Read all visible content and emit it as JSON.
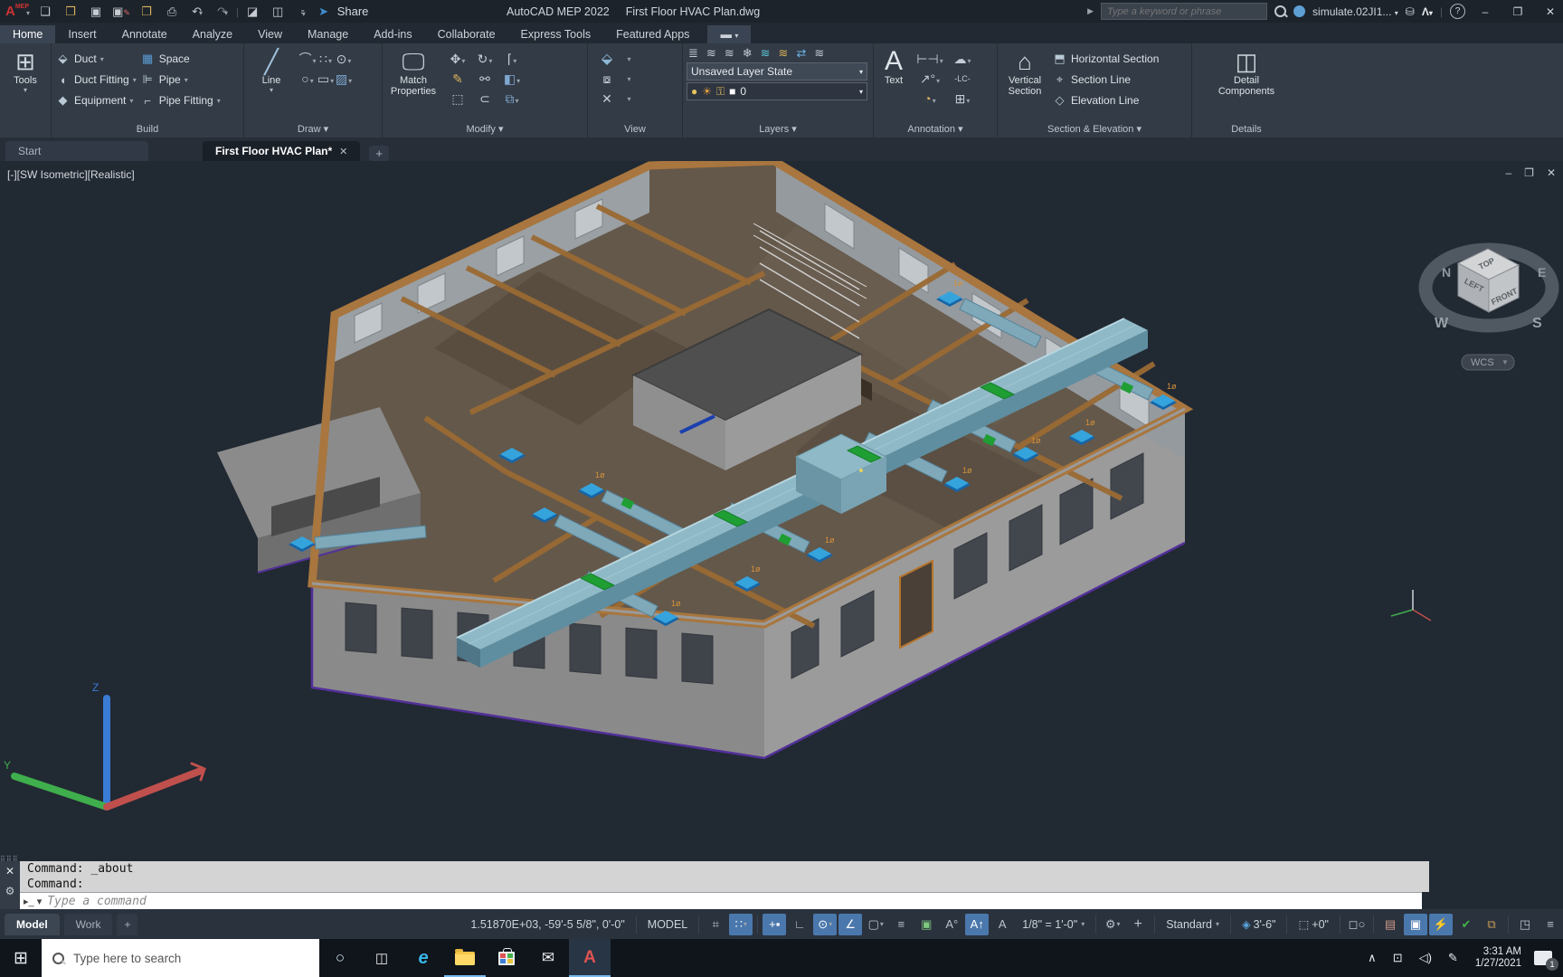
{
  "titlebar": {
    "app_title": "AutoCAD MEP 2022",
    "doc_title": "First Floor HVAC Plan.dwg",
    "share_label": "Share",
    "search_placeholder": "Type a keyword or phrase",
    "user_name": "simulate.02JI1...",
    "window": {
      "minimize": "–",
      "restore": "❐",
      "close": "✕"
    }
  },
  "ribbon": {
    "tabs": [
      {
        "label": "Home"
      },
      {
        "label": "Insert"
      },
      {
        "label": "Annotate"
      },
      {
        "label": "Analyze"
      },
      {
        "label": "View"
      },
      {
        "label": "Manage"
      },
      {
        "label": "Add-ins"
      },
      {
        "label": "Collaborate"
      },
      {
        "label": "Express Tools"
      },
      {
        "label": "Featured Apps"
      }
    ],
    "build": {
      "title": "Build",
      "tools": "Tools",
      "items": [
        "Duct",
        "Duct Fitting",
        "Equipment",
        "Space",
        "Pipe",
        "Pipe Fitting"
      ]
    },
    "draw": {
      "title": "Draw",
      "line": "Line"
    },
    "modify": {
      "title": "Modify",
      "match": "Match",
      "properties": "Properties"
    },
    "view": {
      "title": "View"
    },
    "layers": {
      "title": "Layers",
      "state": "Unsaved Layer State",
      "current": "0"
    },
    "annotation": {
      "title": "Annotation",
      "text": "Text",
      "lc": "-LC-"
    },
    "section": {
      "title": "Section & Elevation",
      "vertical1": "Vertical",
      "vertical2": "Section",
      "horizontal": "Horizontal Section",
      "section_line": "Section Line",
      "elevation_line": "Elevation Line"
    },
    "details": {
      "title": "Details",
      "line1": "Detail",
      "line2": "Components"
    }
  },
  "filetabs": {
    "start": "Start",
    "doc": "First Floor HVAC Plan*",
    "close": "✕",
    "add": "+"
  },
  "viewport": {
    "label": "[-][SW Isometric][Realistic]",
    "viewcube": {
      "top": "TOP",
      "left": "LEFT",
      "front": "FRONT",
      "n": "N",
      "e": "E",
      "s": "S",
      "w": "W",
      "wcs": "WCS"
    }
  },
  "command": {
    "line1": "Command: _about",
    "line2": "Command:",
    "placeholder": "Type a command"
  },
  "layout_tabs": {
    "model": "Model",
    "work": "Work",
    "add": "+"
  },
  "statusbar": {
    "coords": "1.51870E+03, -59'-5 5/8\", 0'-0\"",
    "model": "MODEL",
    "scale": "1/8\" = 1'-0\"",
    "standard": "Standard",
    "elevation": "3'-6\"",
    "z_offset": "+0\""
  },
  "taskbar": {
    "search_placeholder": "Type here to search",
    "time": "3:31 AM",
    "date": "1/27/2021",
    "badge": "1"
  },
  "colors": {
    "viewport_bg": "#212933",
    "wall_cut_tan": "#a8763e",
    "wall_face_gray": "#9b9b9b",
    "floor": "#64584a",
    "duct_top": "#8fb9c6",
    "duct_side": "#5f8ea0",
    "fitting_green": "#1f9e33",
    "diffuser_blue": "#35a3dc",
    "base_purple": "#53309a",
    "status_active_blue": "#4a78ad",
    "label_orange": "#d7923a"
  }
}
